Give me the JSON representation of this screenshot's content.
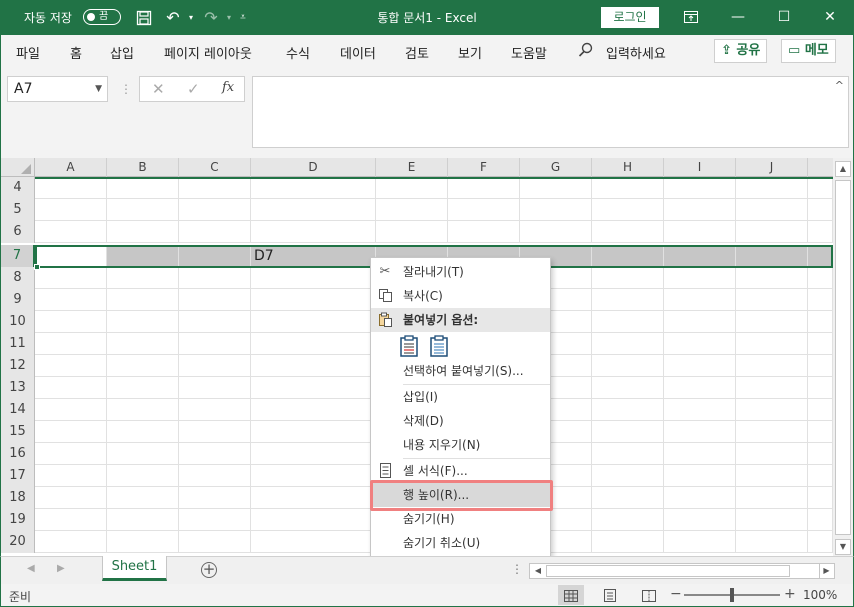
{
  "app": {
    "autosave_label": "자동 저장",
    "autosave_state": "끔",
    "doc_title": "통합 문서1  -  Excel",
    "login_label": "로그인"
  },
  "ribbon": {
    "tabs": [
      "파일",
      "홈",
      "삽입",
      "페이지 레이아웃",
      "수식",
      "데이터",
      "검토",
      "보기",
      "도움말"
    ],
    "search_text": "입력하세요",
    "share_label": "공유",
    "comment_label": "메모"
  },
  "formula_bar": {
    "name_box": "A7",
    "fx_label": "fx",
    "formula_value": ""
  },
  "grid": {
    "columns": [
      "A",
      "B",
      "C",
      "D",
      "E",
      "F",
      "G",
      "H",
      "I",
      "J"
    ],
    "rows": [
      "4",
      "5",
      "6",
      "7",
      "8",
      "9",
      "10",
      "11",
      "12",
      "13",
      "14",
      "15",
      "16",
      "17",
      "18",
      "19",
      "20"
    ],
    "selected_row": "7",
    "cell_d7": "D7"
  },
  "sheet_tabs": {
    "active": "Sheet1",
    "add_label": "+"
  },
  "status_bar": {
    "ready": "준비",
    "zoom": "100%"
  },
  "context_menu": {
    "items": [
      {
        "label": "잘라내기(T)",
        "icon": "scissors-icon"
      },
      {
        "label": "복사(C)",
        "icon": "copy-icon"
      },
      {
        "label": "붙여넣기 옵션:",
        "icon": "paste-icon"
      },
      {
        "label": "선택하여 붙여넣기(S)..."
      },
      {
        "label": "삽입(I)"
      },
      {
        "label": "삭제(D)"
      },
      {
        "label": "내용 지우기(N)"
      },
      {
        "label": "셀 서식(F)...",
        "icon": "format-cells-icon"
      },
      {
        "label": "행 높이(R)..."
      },
      {
        "label": "숨기기(H)"
      },
      {
        "label": "숨기기 취소(U)"
      }
    ]
  },
  "colors": {
    "excel_green": "#217346",
    "annotation_red": "#f08080"
  }
}
